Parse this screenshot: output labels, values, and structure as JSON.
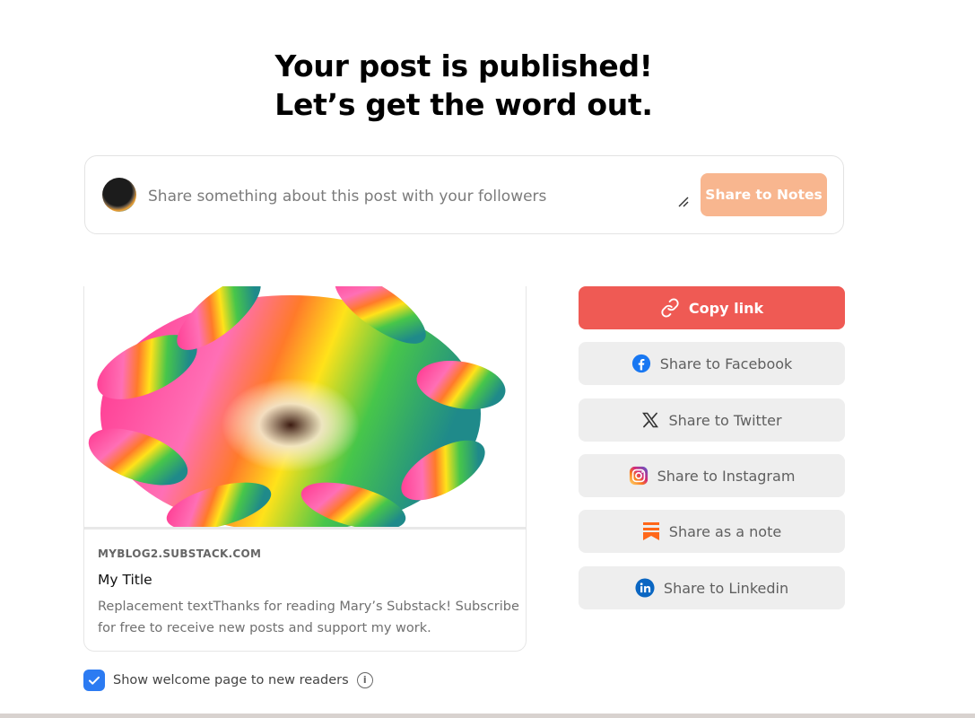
{
  "heading": {
    "line1": "Your post is published!",
    "line2": "Let’s get the word out."
  },
  "composer": {
    "placeholder": "Share something about this post with your followers",
    "share_notes_label": "Share to Notes"
  },
  "card": {
    "domain": "MYBLOG2.SUBSTACK.COM",
    "title": "My Title",
    "description": "Replacement textThanks for reading Mary’s Substack! Subscribe for free to receive new posts and support my work."
  },
  "share_buttons": [
    {
      "label": "Copy link",
      "icon": "link-icon"
    },
    {
      "label": "Share to Facebook",
      "icon": "facebook-icon"
    },
    {
      "label": "Share to Twitter",
      "icon": "x-twitter-icon"
    },
    {
      "label": "Share to Instagram",
      "icon": "instagram-icon"
    },
    {
      "label": "Share as a note",
      "icon": "substack-note-icon"
    },
    {
      "label": "Share to Linkedin",
      "icon": "linkedin-icon"
    }
  ],
  "welcome": {
    "label": "Show welcome page to new readers",
    "checked": true
  },
  "colors": {
    "accent": "#ef5a54",
    "notes_button": "#f8b68f",
    "checkbox": "#2c7bf2",
    "facebook": "#1877f2",
    "linkedin": "#0a66c2",
    "substack": "#ff6719"
  }
}
